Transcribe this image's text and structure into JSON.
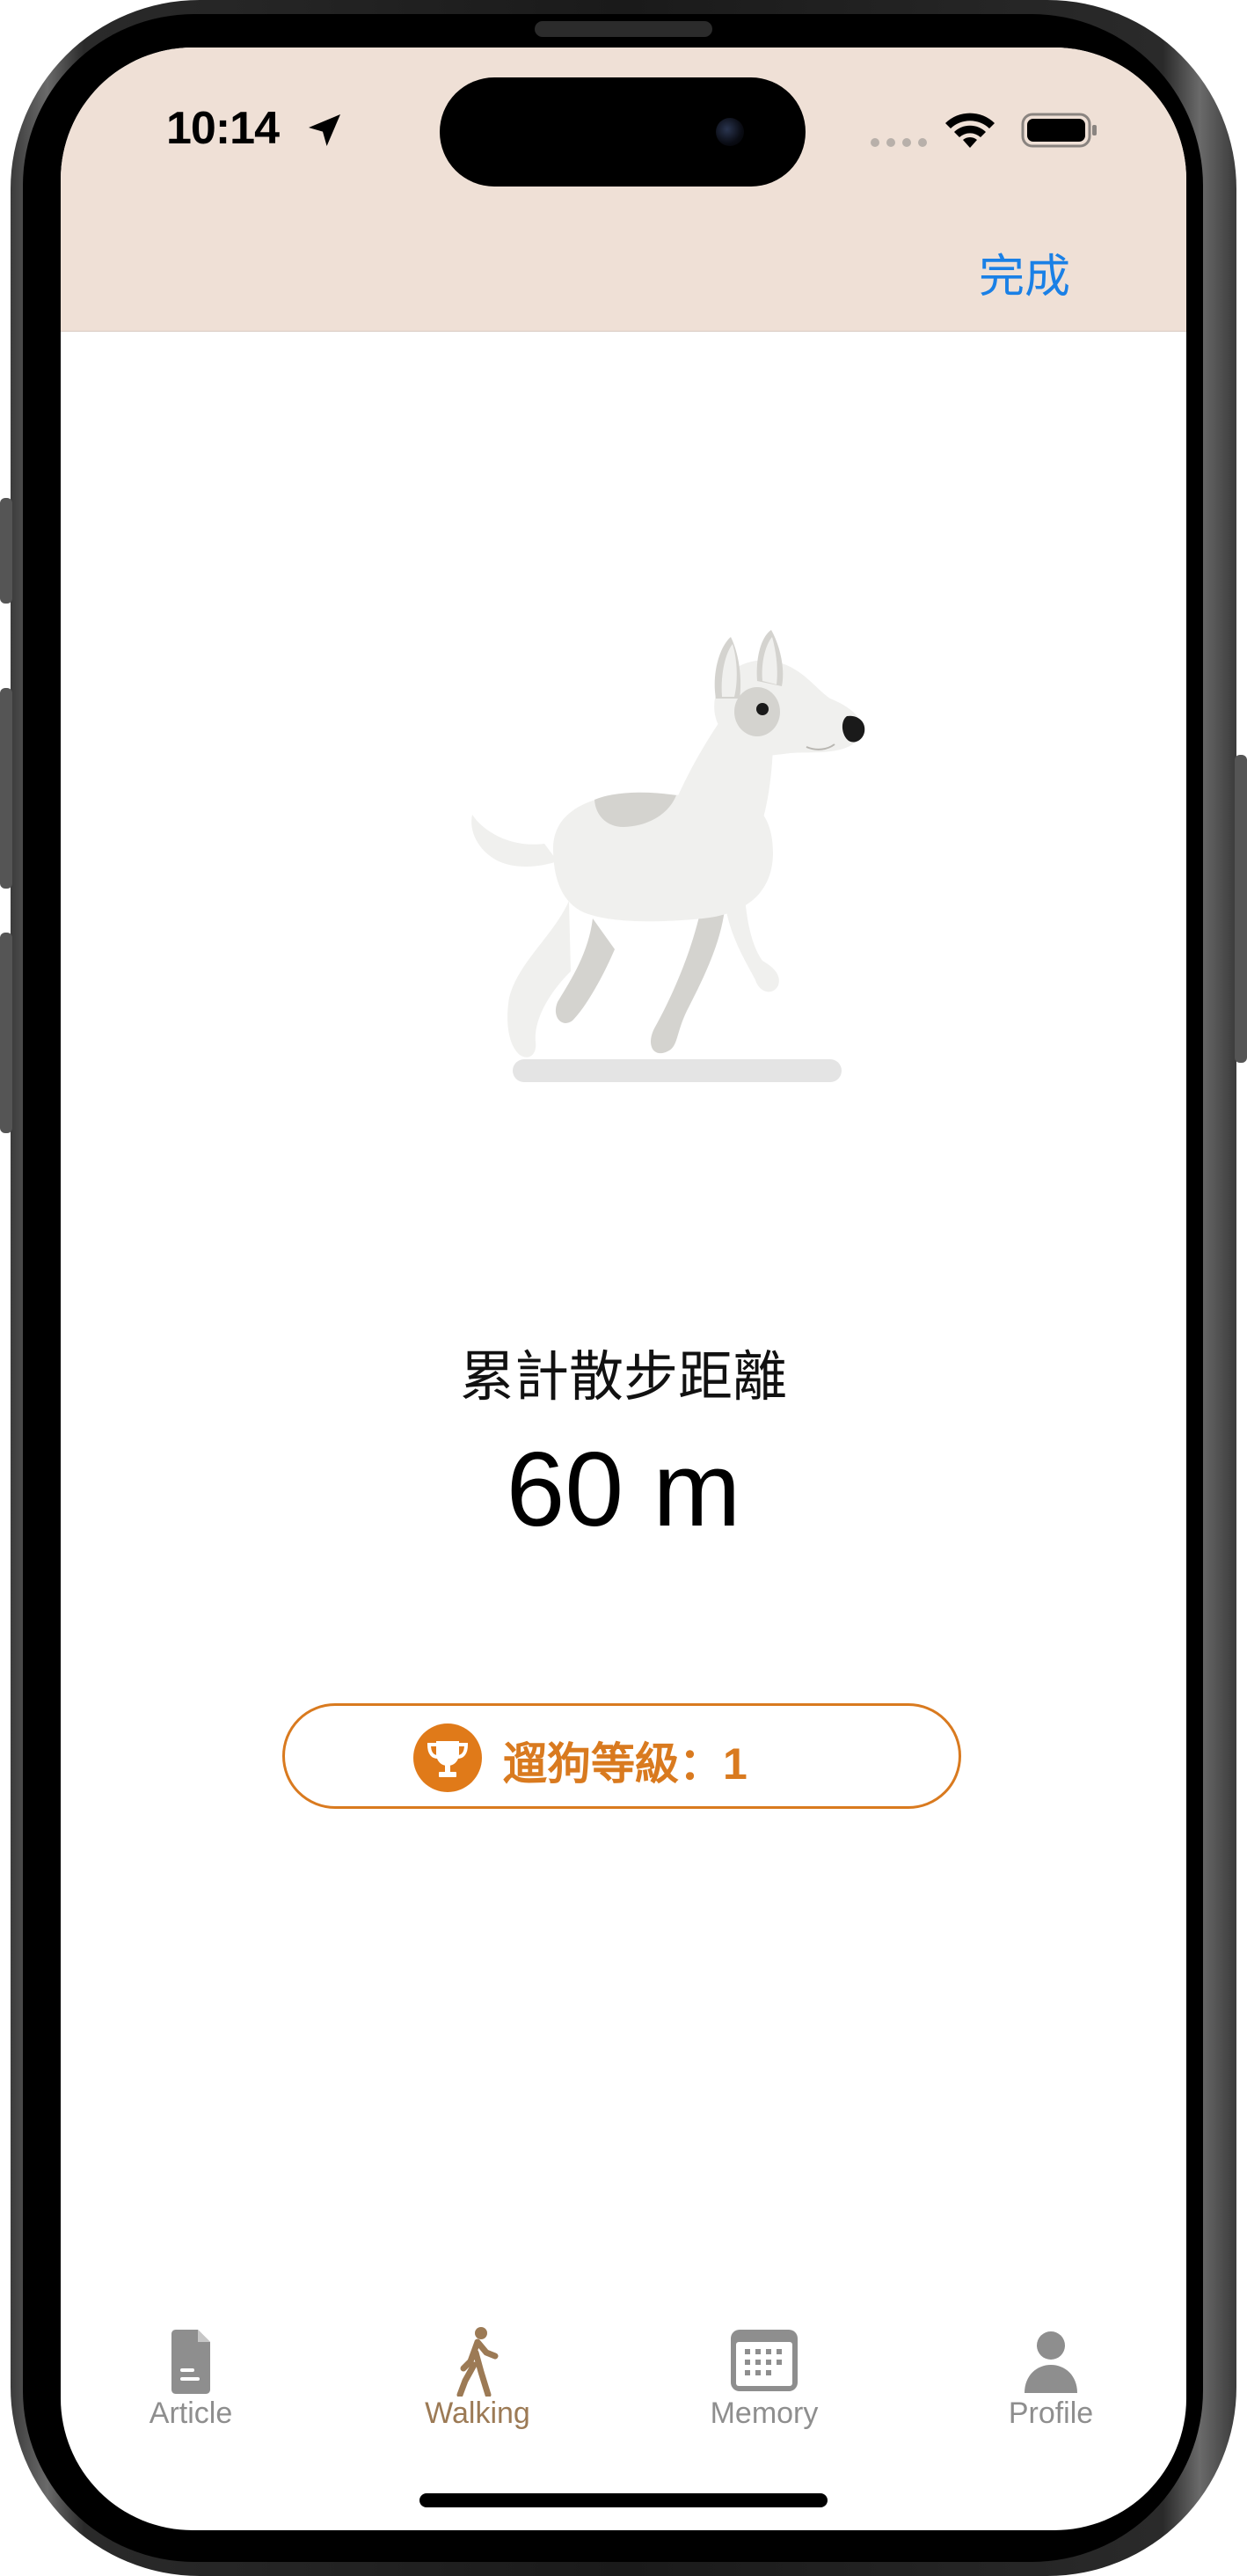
{
  "status_bar": {
    "time": "10:14"
  },
  "nav": {
    "done_label": "完成"
  },
  "walking": {
    "distance_label": "累計散步距離",
    "distance_value": "60 m",
    "level_label": "遛狗等級：1"
  },
  "tabs": [
    {
      "label": "Article",
      "icon": "document-icon",
      "active": false
    },
    {
      "label": "Walking",
      "icon": "walking-person-icon",
      "active": true
    },
    {
      "label": "Memory",
      "icon": "calendar-icon",
      "active": false
    },
    {
      "label": "Profile",
      "icon": "person-icon",
      "active": false
    }
  ],
  "colors": {
    "header_bg": "#efe0d6",
    "accent_blue": "#1a80e6",
    "accent_orange": "#d97a1f",
    "tab_active": "#9c7a55",
    "tab_inactive": "#8e8e8e"
  }
}
